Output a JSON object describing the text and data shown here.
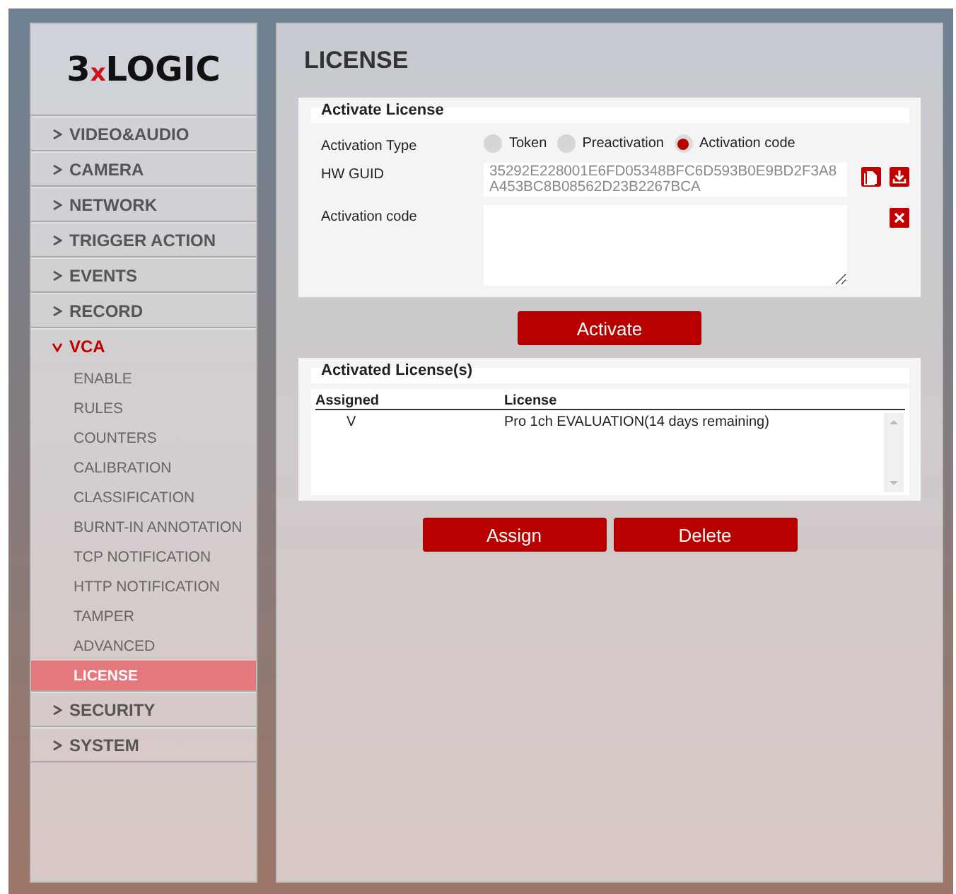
{
  "logo": {
    "prefix": "3",
    "mark": "x",
    "suffix": "LOGIC"
  },
  "nav": [
    {
      "label": "VIDEO&AUDIO",
      "expanded": false
    },
    {
      "label": "CAMERA",
      "expanded": false
    },
    {
      "label": "NETWORK",
      "expanded": false
    },
    {
      "label": "TRIGGER ACTION",
      "expanded": false
    },
    {
      "label": "EVENTS",
      "expanded": false
    },
    {
      "label": "RECORD",
      "expanded": false
    },
    {
      "label": "VCA",
      "expanded": true,
      "children": [
        {
          "label": "ENABLE",
          "selected": false
        },
        {
          "label": "RULES",
          "selected": false
        },
        {
          "label": "COUNTERS",
          "selected": false
        },
        {
          "label": "CALIBRATION",
          "selected": false
        },
        {
          "label": "CLASSIFICATION",
          "selected": false
        },
        {
          "label": "BURNT-IN ANNOTATION",
          "selected": false
        },
        {
          "label": "TCP NOTIFICATION",
          "selected": false
        },
        {
          "label": "HTTP NOTIFICATION",
          "selected": false
        },
        {
          "label": "TAMPER",
          "selected": false
        },
        {
          "label": "ADVANCED",
          "selected": false
        },
        {
          "label": "LICENSE",
          "selected": true
        }
      ]
    },
    {
      "label": "SECURITY",
      "expanded": false
    },
    {
      "label": "SYSTEM",
      "expanded": false
    }
  ],
  "page_title": "LICENSE",
  "activate_section": {
    "title": "Activate License",
    "activation_type": {
      "label": "Activation Type",
      "options": [
        {
          "label": "Token",
          "selected": false
        },
        {
          "label": "Preactivation",
          "selected": false
        },
        {
          "label": "Activation code",
          "selected": true
        }
      ]
    },
    "hw_guid": {
      "label": "HW GUID",
      "value": "35292E228001E6FD05348BFC6D593B0E9BD2F3A8A453BC8B08562D23B2267BCA"
    },
    "activation_code": {
      "label": "Activation code"
    },
    "button": "Activate"
  },
  "licenses_section": {
    "title": "Activated License(s)",
    "columns": [
      "Assigned",
      "License"
    ],
    "rows": [
      [
        "V",
        "Pro 1ch EVALUATION(14 days remaining)"
      ]
    ]
  },
  "buttons": [
    "Assign",
    "Delete"
  ]
}
